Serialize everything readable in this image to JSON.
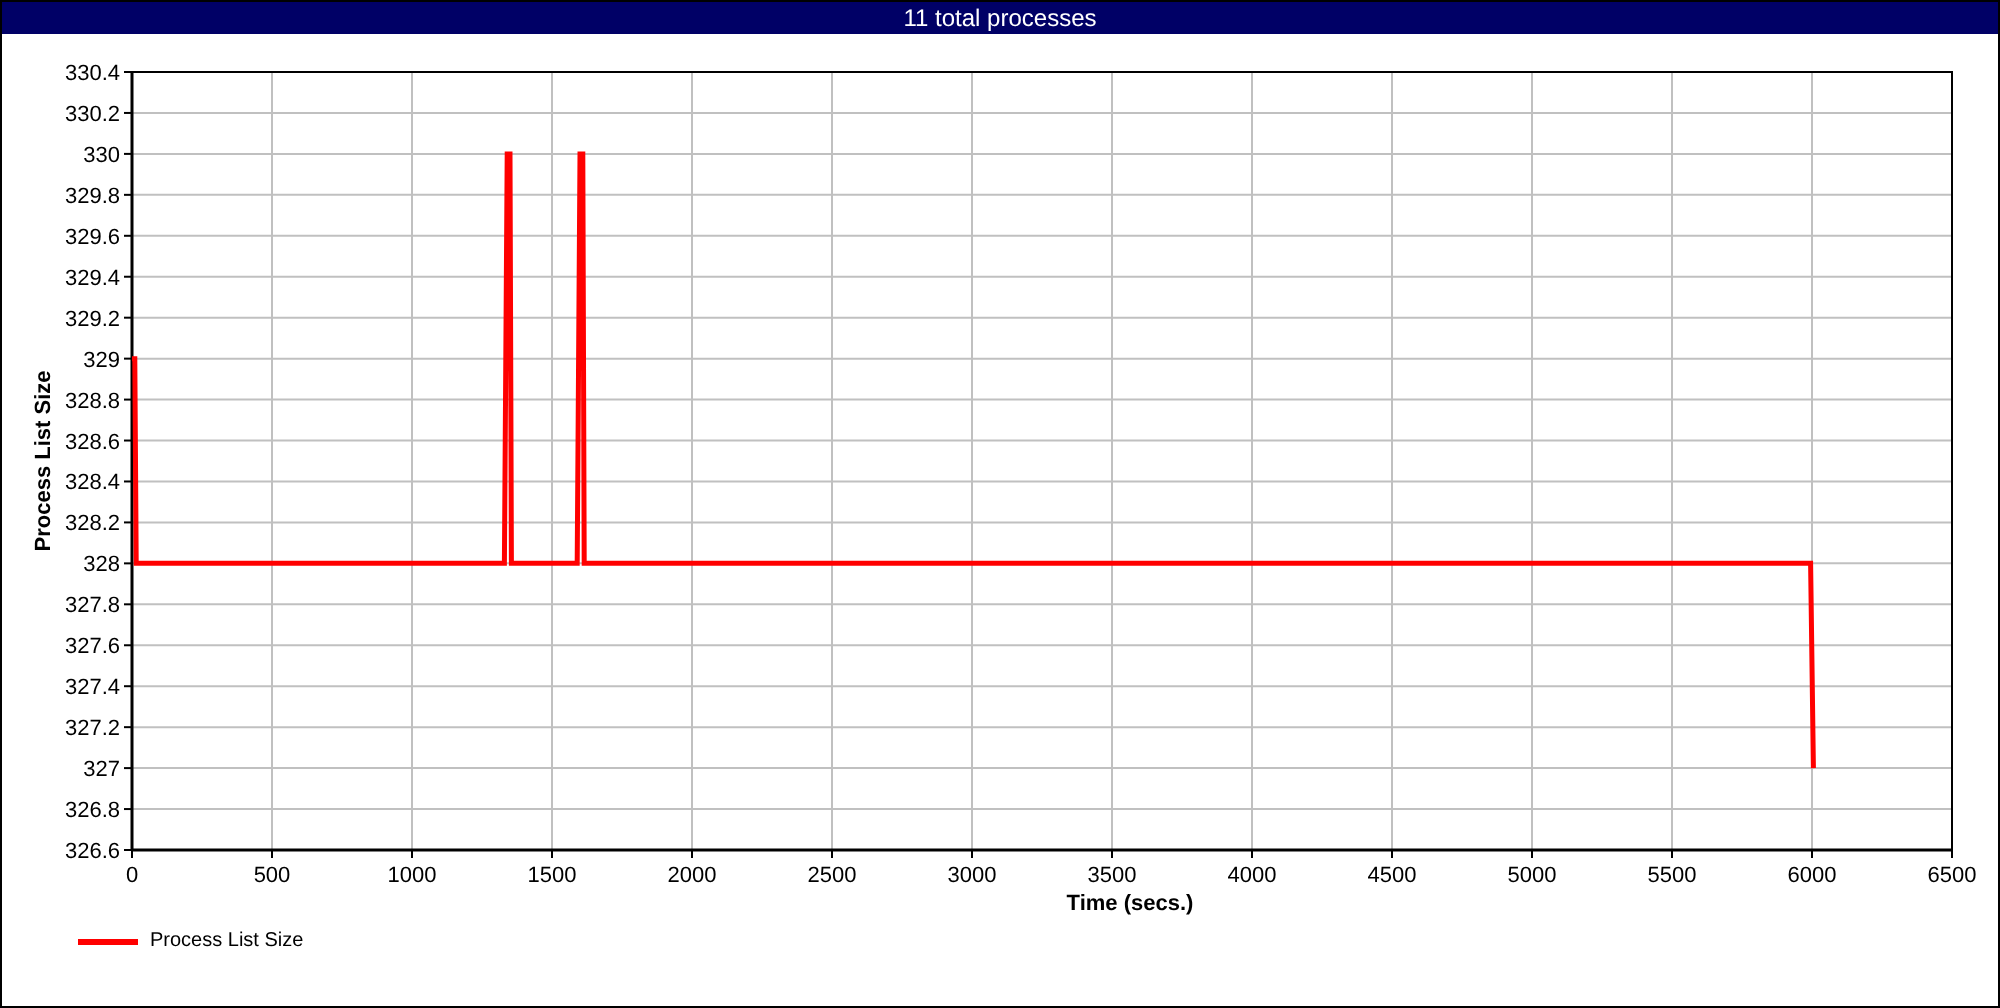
{
  "title": "11 total processes",
  "chart_data": {
    "type": "line",
    "grid": true,
    "xlabel": "Time (secs.)",
    "ylabel": "Process List Size",
    "xlim": [
      0,
      6500
    ],
    "ylim": [
      326.6,
      330.4
    ],
    "xticks": [
      0,
      500,
      1000,
      1500,
      2000,
      2500,
      3000,
      3500,
      4000,
      4500,
      5000,
      5500,
      6000,
      6500
    ],
    "yticks": [
      326.6,
      326.8,
      327,
      327.2,
      327.4,
      327.6,
      327.8,
      328,
      328.2,
      328.4,
      328.6,
      328.8,
      329,
      329.2,
      329.4,
      329.6,
      329.8,
      330,
      330.2,
      330.4
    ],
    "x": [
      0,
      10,
      15,
      1330,
      1340,
      1350,
      1355,
      1590,
      1600,
      1610,
      1615,
      5995,
      6005
    ],
    "series": [
      {
        "name": "Process List Size",
        "color": "#ff0000",
        "values": [
          329,
          329,
          328,
          328,
          330,
          330,
          328,
          328,
          330,
          330,
          328,
          328,
          327
        ]
      }
    ]
  }
}
